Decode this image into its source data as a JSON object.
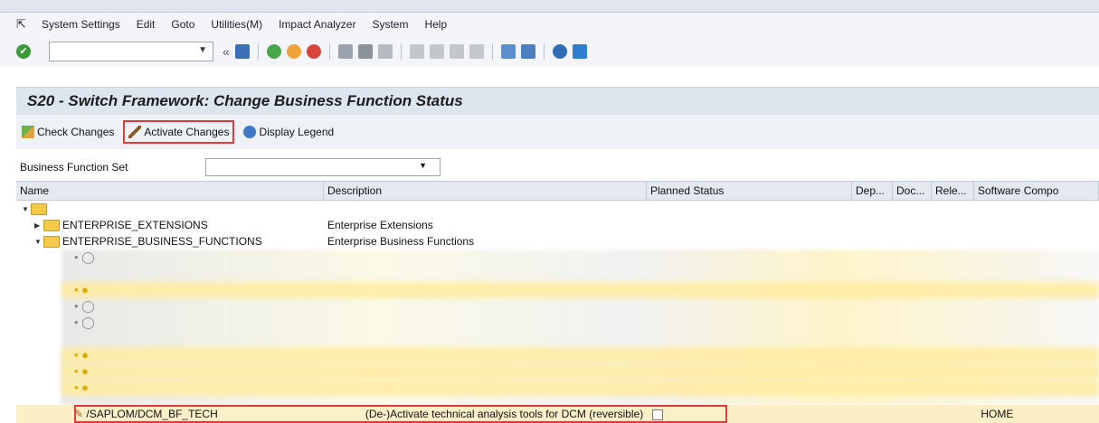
{
  "menu": [
    "System Settings",
    "Edit",
    "Goto",
    "Utilities(M)",
    "Impact Analyzer",
    "System",
    "Help"
  ],
  "title": "S20 - Switch Framework: Change Business Function Status",
  "app_toolbar": {
    "check": "Check Changes",
    "activate": "Activate Changes",
    "legend": "Display Legend"
  },
  "bfs": {
    "label": "Business Function Set",
    "value": ""
  },
  "columns": [
    "Name",
    "Description",
    "Planned Status",
    "Dep...",
    "Doc...",
    "Rele...",
    "Software Compo"
  ],
  "rows": [
    {
      "name": "",
      "desc": ""
    },
    {
      "name": "ENTERPRISE_EXTENSIONS",
      "desc": "Enterprise Extensions"
    },
    {
      "name": "ENTERPRISE_BUSINESS_FUNCTIONS",
      "desc": "Enterprise Business Functions"
    }
  ],
  "selected": {
    "name": "/SAPLOM/DCM_BF_TECH",
    "desc": "(De-)Activate technical analysis tools for DCM (reversible)",
    "software": "HOME"
  },
  "colors": {
    "title_bg": "#dde5ee",
    "highlight": "#e23b3b",
    "row_yellow": "#fbefc8"
  }
}
